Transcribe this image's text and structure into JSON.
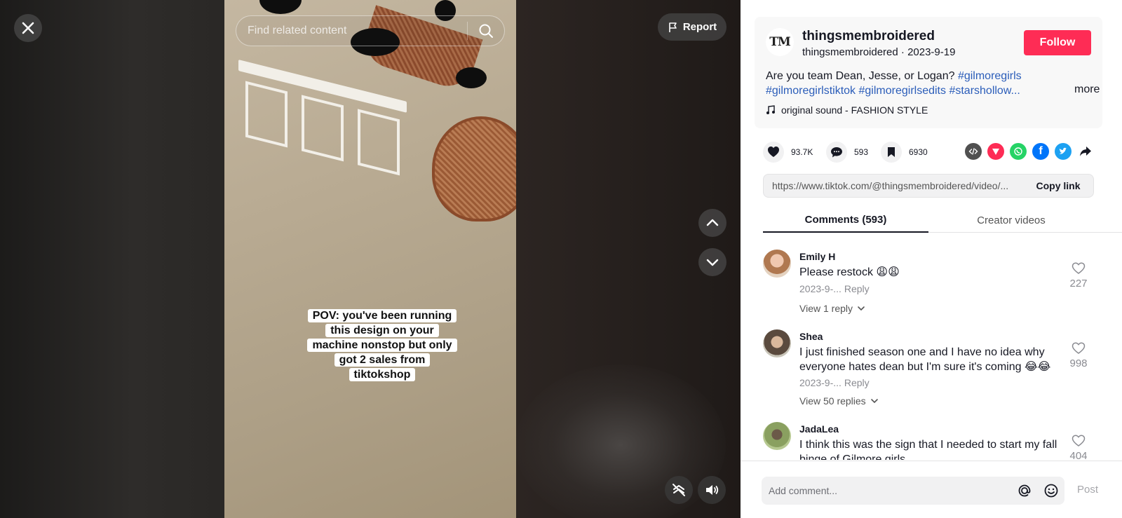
{
  "video": {
    "close_icon": "close-icon",
    "search": {
      "placeholder": "Find related content",
      "icon": "search-icon"
    },
    "report_label": "Report",
    "caption_lines": [
      "POV: you've been running",
      "this design on your",
      "machine nonstop but only",
      "got 2 sales from",
      "tiktokshop"
    ],
    "nav": {
      "up_icon": "chevron-up-icon",
      "down_icon": "chevron-down-icon"
    },
    "controls": {
      "autoscroll_icon": "autoscroll-off-icon",
      "volume_icon": "volume-icon"
    }
  },
  "author": {
    "avatar_text": "TM",
    "display_name": "thingsmembroidered",
    "handle_line": "thingsmembroidered · 2023-9-19",
    "follow_label": "Follow"
  },
  "description": {
    "text": "Are you team Dean, Jesse, or Logan? ",
    "tags": [
      "#gilmoregirls",
      "#gilmoregirlstiktok",
      "#gilmoregirlsedits",
      "#starshollow..."
    ],
    "more_label": "more"
  },
  "music": {
    "icon": "music-note-icon",
    "label": "original sound - FASHION STYLE"
  },
  "stats": {
    "likes": "93.7K",
    "comments": "593",
    "saves": "6930"
  },
  "share": {
    "icons": [
      "embed-icon",
      "send-to-friends-icon",
      "whatsapp-icon",
      "facebook-icon",
      "twitter-icon",
      "share-arrow-icon"
    ],
    "colors": {
      "embed": "#505050",
      "send": "#fe2c55",
      "whatsapp": "#25d366",
      "facebook": "#0075fa",
      "twitter": "#1da1f2"
    }
  },
  "link": {
    "url": "https://www.tiktok.com/@thingsmembroidered/video/...",
    "copy_label": "Copy link"
  },
  "tabs": {
    "comments": "Comments (593)",
    "creator": "Creator videos"
  },
  "comments": [
    {
      "name": "Emily H",
      "text": "Please restock 😩😩",
      "date": "2023-9-...",
      "reply": "Reply",
      "replies": "View 1 reply",
      "likes": "227"
    },
    {
      "name": "Shea",
      "text": "I just finished season one and I have no idea why everyone hates dean but I'm sure it's coming 😂😂",
      "date": "2023-9-...",
      "reply": "Reply",
      "replies": "View 50 replies",
      "likes": "998"
    },
    {
      "name": "JadaLea",
      "text": "I think this was the sign that I needed to start my fall binge of Gilmore girls",
      "likes": "404"
    }
  ],
  "comment_bar": {
    "placeholder": "Add comment...",
    "mention_icon": "at-mention-icon",
    "emoji_icon": "emoji-icon",
    "post_label": "Post"
  },
  "colors": {
    "accent": "#fe2c55",
    "tag_blue": "#2b5db9",
    "text": "#161823",
    "muted": "#8a8b91"
  }
}
